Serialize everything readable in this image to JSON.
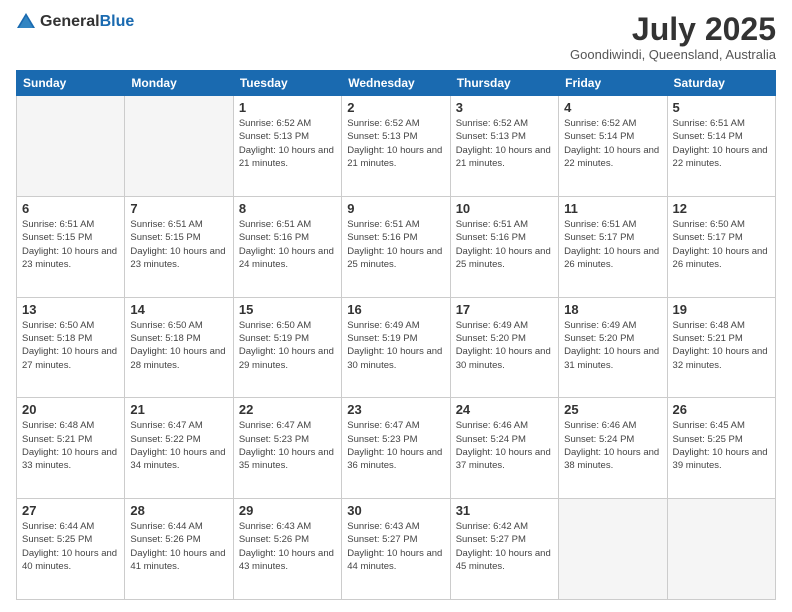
{
  "logo": {
    "general": "General",
    "blue": "Blue"
  },
  "title": "July 2025",
  "subtitle": "Goondiwindi, Queensland, Australia",
  "weekdays": [
    "Sunday",
    "Monday",
    "Tuesday",
    "Wednesday",
    "Thursday",
    "Friday",
    "Saturday"
  ],
  "weeks": [
    [
      {
        "day": "",
        "info": ""
      },
      {
        "day": "",
        "info": ""
      },
      {
        "day": "1",
        "info": "Sunrise: 6:52 AM\nSunset: 5:13 PM\nDaylight: 10 hours and 21 minutes."
      },
      {
        "day": "2",
        "info": "Sunrise: 6:52 AM\nSunset: 5:13 PM\nDaylight: 10 hours and 21 minutes."
      },
      {
        "day": "3",
        "info": "Sunrise: 6:52 AM\nSunset: 5:13 PM\nDaylight: 10 hours and 21 minutes."
      },
      {
        "day": "4",
        "info": "Sunrise: 6:52 AM\nSunset: 5:14 PM\nDaylight: 10 hours and 22 minutes."
      },
      {
        "day": "5",
        "info": "Sunrise: 6:51 AM\nSunset: 5:14 PM\nDaylight: 10 hours and 22 minutes."
      }
    ],
    [
      {
        "day": "6",
        "info": "Sunrise: 6:51 AM\nSunset: 5:15 PM\nDaylight: 10 hours and 23 minutes."
      },
      {
        "day": "7",
        "info": "Sunrise: 6:51 AM\nSunset: 5:15 PM\nDaylight: 10 hours and 23 minutes."
      },
      {
        "day": "8",
        "info": "Sunrise: 6:51 AM\nSunset: 5:16 PM\nDaylight: 10 hours and 24 minutes."
      },
      {
        "day": "9",
        "info": "Sunrise: 6:51 AM\nSunset: 5:16 PM\nDaylight: 10 hours and 25 minutes."
      },
      {
        "day": "10",
        "info": "Sunrise: 6:51 AM\nSunset: 5:16 PM\nDaylight: 10 hours and 25 minutes."
      },
      {
        "day": "11",
        "info": "Sunrise: 6:51 AM\nSunset: 5:17 PM\nDaylight: 10 hours and 26 minutes."
      },
      {
        "day": "12",
        "info": "Sunrise: 6:50 AM\nSunset: 5:17 PM\nDaylight: 10 hours and 26 minutes."
      }
    ],
    [
      {
        "day": "13",
        "info": "Sunrise: 6:50 AM\nSunset: 5:18 PM\nDaylight: 10 hours and 27 minutes."
      },
      {
        "day": "14",
        "info": "Sunrise: 6:50 AM\nSunset: 5:18 PM\nDaylight: 10 hours and 28 minutes."
      },
      {
        "day": "15",
        "info": "Sunrise: 6:50 AM\nSunset: 5:19 PM\nDaylight: 10 hours and 29 minutes."
      },
      {
        "day": "16",
        "info": "Sunrise: 6:49 AM\nSunset: 5:19 PM\nDaylight: 10 hours and 30 minutes."
      },
      {
        "day": "17",
        "info": "Sunrise: 6:49 AM\nSunset: 5:20 PM\nDaylight: 10 hours and 30 minutes."
      },
      {
        "day": "18",
        "info": "Sunrise: 6:49 AM\nSunset: 5:20 PM\nDaylight: 10 hours and 31 minutes."
      },
      {
        "day": "19",
        "info": "Sunrise: 6:48 AM\nSunset: 5:21 PM\nDaylight: 10 hours and 32 minutes."
      }
    ],
    [
      {
        "day": "20",
        "info": "Sunrise: 6:48 AM\nSunset: 5:21 PM\nDaylight: 10 hours and 33 minutes."
      },
      {
        "day": "21",
        "info": "Sunrise: 6:47 AM\nSunset: 5:22 PM\nDaylight: 10 hours and 34 minutes."
      },
      {
        "day": "22",
        "info": "Sunrise: 6:47 AM\nSunset: 5:23 PM\nDaylight: 10 hours and 35 minutes."
      },
      {
        "day": "23",
        "info": "Sunrise: 6:47 AM\nSunset: 5:23 PM\nDaylight: 10 hours and 36 minutes."
      },
      {
        "day": "24",
        "info": "Sunrise: 6:46 AM\nSunset: 5:24 PM\nDaylight: 10 hours and 37 minutes."
      },
      {
        "day": "25",
        "info": "Sunrise: 6:46 AM\nSunset: 5:24 PM\nDaylight: 10 hours and 38 minutes."
      },
      {
        "day": "26",
        "info": "Sunrise: 6:45 AM\nSunset: 5:25 PM\nDaylight: 10 hours and 39 minutes."
      }
    ],
    [
      {
        "day": "27",
        "info": "Sunrise: 6:44 AM\nSunset: 5:25 PM\nDaylight: 10 hours and 40 minutes."
      },
      {
        "day": "28",
        "info": "Sunrise: 6:44 AM\nSunset: 5:26 PM\nDaylight: 10 hours and 41 minutes."
      },
      {
        "day": "29",
        "info": "Sunrise: 6:43 AM\nSunset: 5:26 PM\nDaylight: 10 hours and 43 minutes."
      },
      {
        "day": "30",
        "info": "Sunrise: 6:43 AM\nSunset: 5:27 PM\nDaylight: 10 hours and 44 minutes."
      },
      {
        "day": "31",
        "info": "Sunrise: 6:42 AM\nSunset: 5:27 PM\nDaylight: 10 hours and 45 minutes."
      },
      {
        "day": "",
        "info": ""
      },
      {
        "day": "",
        "info": ""
      }
    ]
  ]
}
